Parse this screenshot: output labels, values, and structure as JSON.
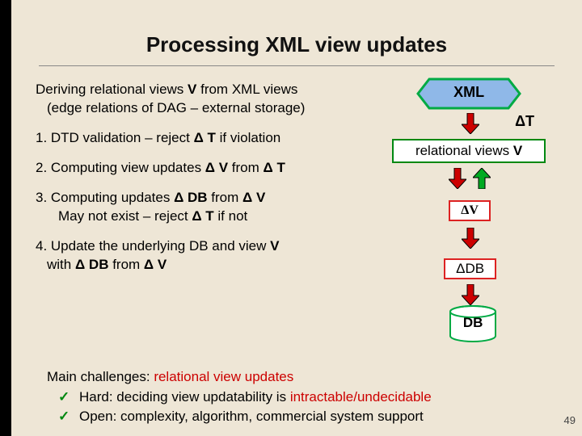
{
  "title": "Processing XML view updates",
  "left": {
    "l1a": "Deriving relational views ",
    "l1b": "V",
    "l1c": " from XML views",
    "l1d": "(edge relations of DAG – external storage)",
    "s1a": "1. DTD validation – reject ",
    "s1b": "Δ T",
    "s1c": " if violation",
    "s2a": "2. Computing view updates ",
    "s2b": "Δ V",
    "s2c": " from ",
    "s2d": "Δ T",
    "s3a": "3. Computing updates ",
    "s3b": "Δ DB",
    "s3c": " from ",
    "s3d": "Δ V",
    "s3e": "May not exist – reject ",
    "s3f": "Δ T",
    "s3g": " if not",
    "s4a": "4. Update the underlying DB and view ",
    "s4b": "V",
    "s4c": "with ",
    "s4d": "Δ DB",
    "s4e": " from ",
    "s4f": "Δ V"
  },
  "right": {
    "xml": "XML",
    "dt": "ΔT",
    "rel_a": "relational views ",
    "rel_b": "V",
    "dv": "ΔV",
    "ddb": "ΔDB",
    "db": "DB"
  },
  "challenges": {
    "intro_a": "Main challenges: ",
    "intro_b": "relational view updates",
    "b1a": "Hard: deciding view updatability is ",
    "b1b": "intractable/undecidable",
    "b2a": "Open: complexity, algorithm, commercial system support"
  },
  "slidenum": "49"
}
